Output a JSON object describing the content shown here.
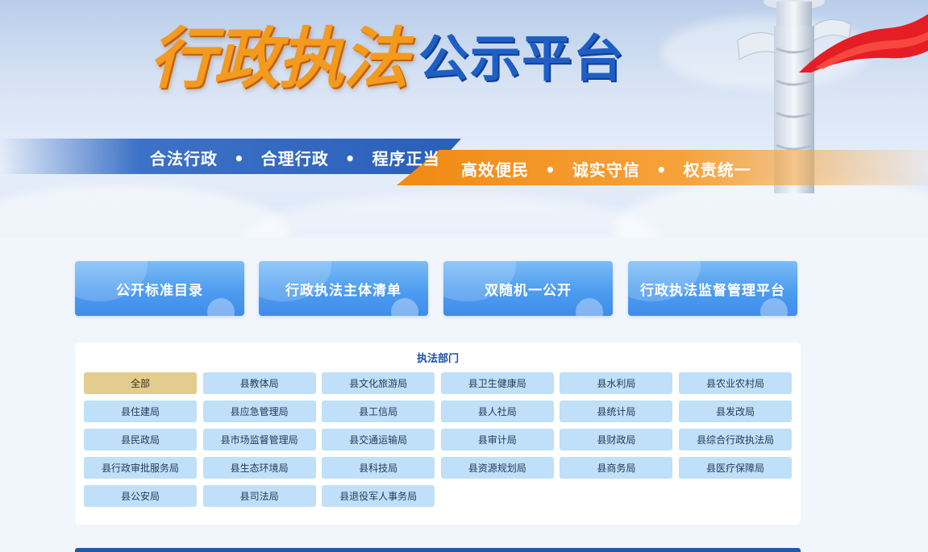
{
  "banner": {
    "title_main": "行政执法",
    "title_sub": "公示平台",
    "motto_left": [
      "合法行政",
      "合理行政",
      "程序正当"
    ],
    "motto_right": [
      "高效便民",
      "诚实守信",
      "权责统一"
    ],
    "separator": "•"
  },
  "nav": {
    "buttons": [
      {
        "label": "公开标准目录"
      },
      {
        "label": "行政执法主体清单"
      },
      {
        "label": "双随机一公开"
      },
      {
        "label": "行政执法监督管理平台"
      }
    ]
  },
  "departments": {
    "title": "执法部门",
    "active_index": 0,
    "items": [
      "全部",
      "县教体局",
      "县文化旅游局",
      "县卫生健康局",
      "县水利局",
      "县农业农村局",
      "县住建局",
      "县应急管理局",
      "县工信局",
      "县人社局",
      "县统计局",
      "县发改局",
      "县民政局",
      "县市场监督管理局",
      "县交通运输局",
      "县审计局",
      "县财政局",
      "县综合行政执法局",
      "县行政审批服务局",
      "县生态环境局",
      "县科技局",
      "县资源规划局",
      "县商务局",
      "县医疗保障局",
      "县公安局",
      "县司法局",
      "县退役军人事务局"
    ]
  },
  "colors": {
    "title_orange": "#f39a1f",
    "title_blue": "#1f5fc5",
    "nav_button_blue": "#4d9cf0",
    "dept_default": "#bfe0f8",
    "dept_active": "#e2cd8f",
    "panel_title": "#1b4fa3"
  }
}
